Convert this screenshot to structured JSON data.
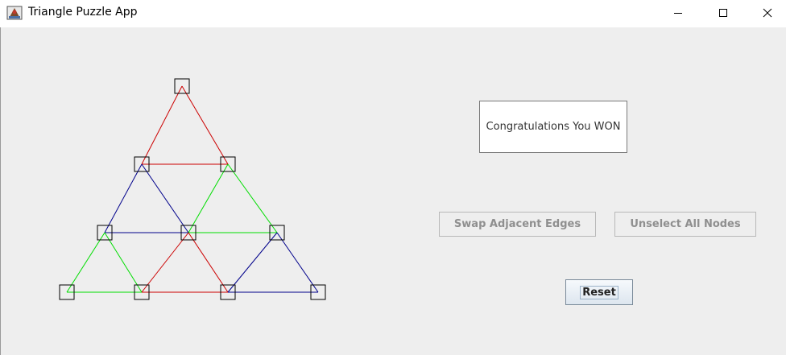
{
  "window": {
    "title": "Triangle Puzzle App",
    "app_icon": "java-app-icon",
    "controls": [
      "minimize-icon",
      "maximize-icon",
      "close-icon"
    ]
  },
  "status": {
    "message": "Congratulations You WON"
  },
  "buttons": {
    "swap": "Swap Adjacent Edges",
    "unselect": "Unselect All Nodes",
    "reset": "Reset"
  },
  "colors": {
    "red": "#cc0000",
    "green": "#00dd00",
    "blue": "#00008b",
    "background": "#eeeeee"
  },
  "puzzle": {
    "nodes": [
      "n0",
      "n1",
      "n2",
      "n3",
      "n4",
      "n5",
      "n6",
      "n7",
      "n8",
      "n9"
    ],
    "edges": [
      {
        "from": "n0",
        "to": "n1",
        "color": "red"
      },
      {
        "from": "n0",
        "to": "n2",
        "color": "red"
      },
      {
        "from": "n1",
        "to": "n2",
        "color": "red"
      },
      {
        "from": "n1",
        "to": "n3",
        "color": "blue"
      },
      {
        "from": "n1",
        "to": "n4",
        "color": "blue"
      },
      {
        "from": "n3",
        "to": "n4",
        "color": "blue"
      },
      {
        "from": "n2",
        "to": "n4",
        "color": "green"
      },
      {
        "from": "n2",
        "to": "n5",
        "color": "green"
      },
      {
        "from": "n4",
        "to": "n5",
        "color": "green"
      },
      {
        "from": "n3",
        "to": "n6",
        "color": "green"
      },
      {
        "from": "n3",
        "to": "n7",
        "color": "green"
      },
      {
        "from": "n6",
        "to": "n7",
        "color": "green"
      },
      {
        "from": "n4",
        "to": "n7",
        "color": "red"
      },
      {
        "from": "n4",
        "to": "n8",
        "color": "red"
      },
      {
        "from": "n7",
        "to": "n8",
        "color": "red"
      },
      {
        "from": "n5",
        "to": "n8",
        "color": "blue"
      },
      {
        "from": "n5",
        "to": "n9",
        "color": "blue"
      },
      {
        "from": "n8",
        "to": "n9",
        "color": "blue"
      }
    ]
  }
}
